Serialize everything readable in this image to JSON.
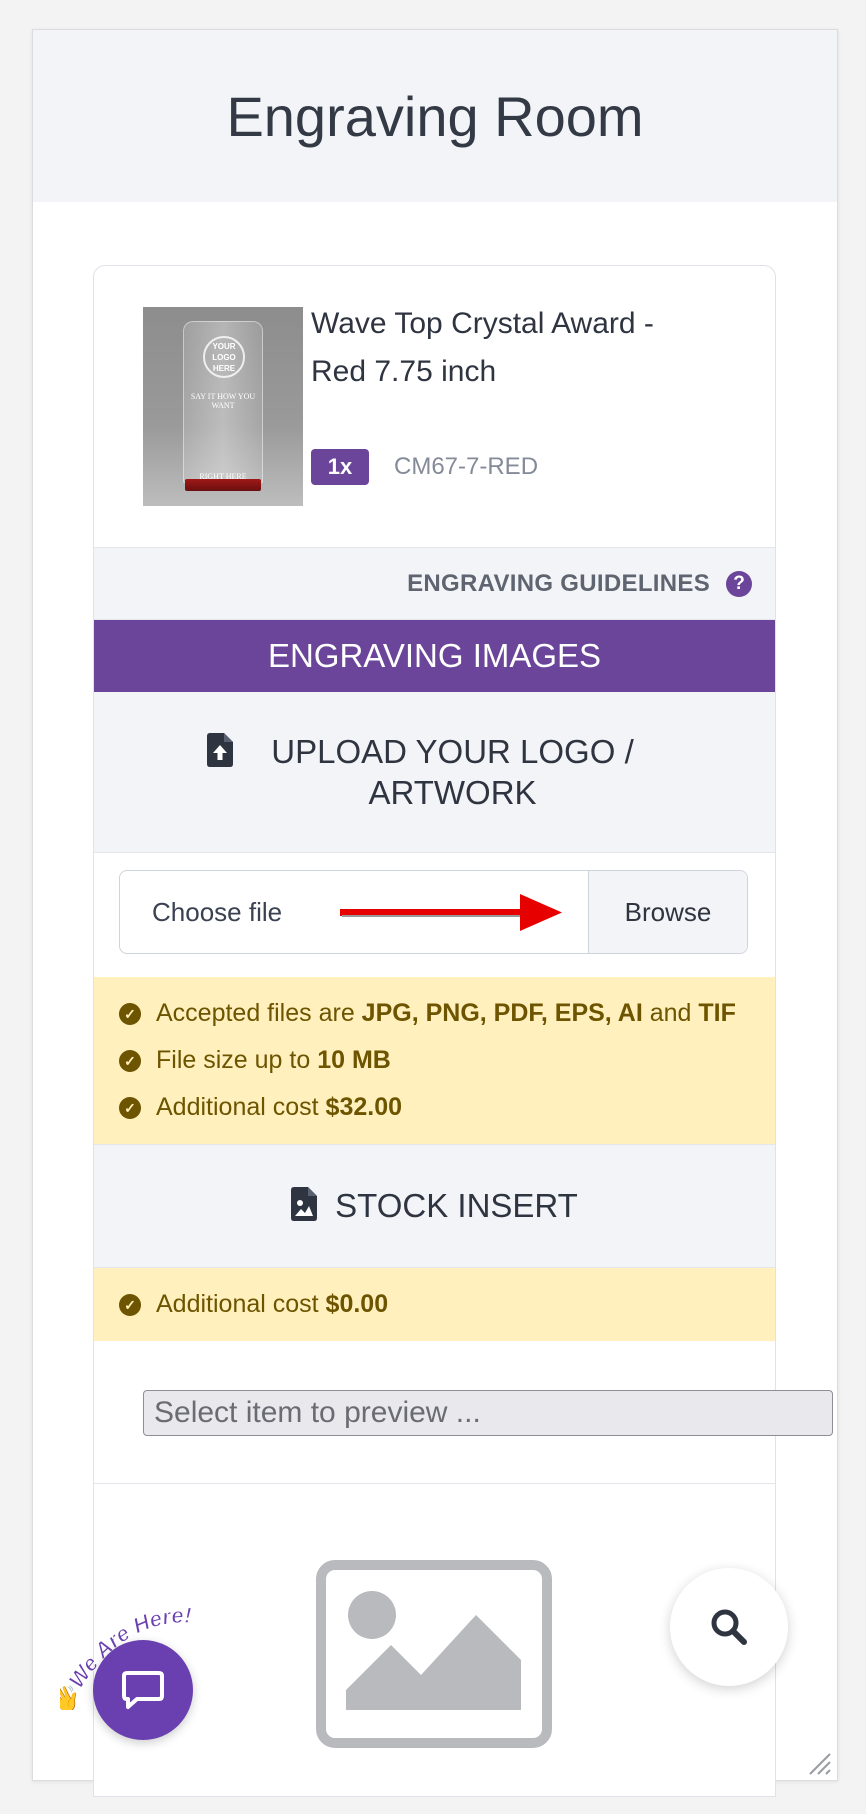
{
  "page": {
    "title": "Engraving Room"
  },
  "product": {
    "name_line1": "Wave Top Crystal Award -",
    "name_line2": "Red 7.75 inch",
    "quantity": "1x",
    "sku": "CM67-7-RED",
    "image": {
      "logo_text": "YOUR LOGO HERE",
      "tagline": "SAY IT HOW YOU WANT",
      "footer": "RIGHT HERE"
    }
  },
  "guidelines": {
    "label": "ENGRAVING GUIDELINES",
    "icon": "question-circle-icon"
  },
  "engraving_images": {
    "title": "ENGRAVING IMAGES"
  },
  "upload": {
    "label": "UPLOAD YOUR LOGO / ARTWORK",
    "icon": "file-upload-icon",
    "file_label": "Choose file",
    "browse_label": "Browse"
  },
  "upload_notes": {
    "accepted_prefix": "Accepted files are ",
    "accepted_types": "JPG, PNG, PDF, EPS, AI",
    "accepted_and": " and ",
    "accepted_last": "TIF",
    "size_prefix": "File size up to ",
    "size_value": "10 MB",
    "cost_prefix": "Additional cost ",
    "cost_value": "$32.00"
  },
  "stock_insert": {
    "label": "STOCK INSERT",
    "icon": "file-image-icon",
    "cost_prefix": "Additional cost ",
    "cost_value": "$0.00"
  },
  "preview_select": {
    "placeholder": "Select item to preview ..."
  },
  "chat_widget": {
    "badge_text": "We Are Here!",
    "icon": "chat-bubble-icon"
  },
  "search_fab": {
    "icon": "search-icon"
  },
  "colors": {
    "brand_purple": "#6a4599",
    "notice_bg": "#fff0bd",
    "notice_text": "#6d5400",
    "header_bg": "#f3f4f7",
    "arrow_red": "#e60000"
  }
}
